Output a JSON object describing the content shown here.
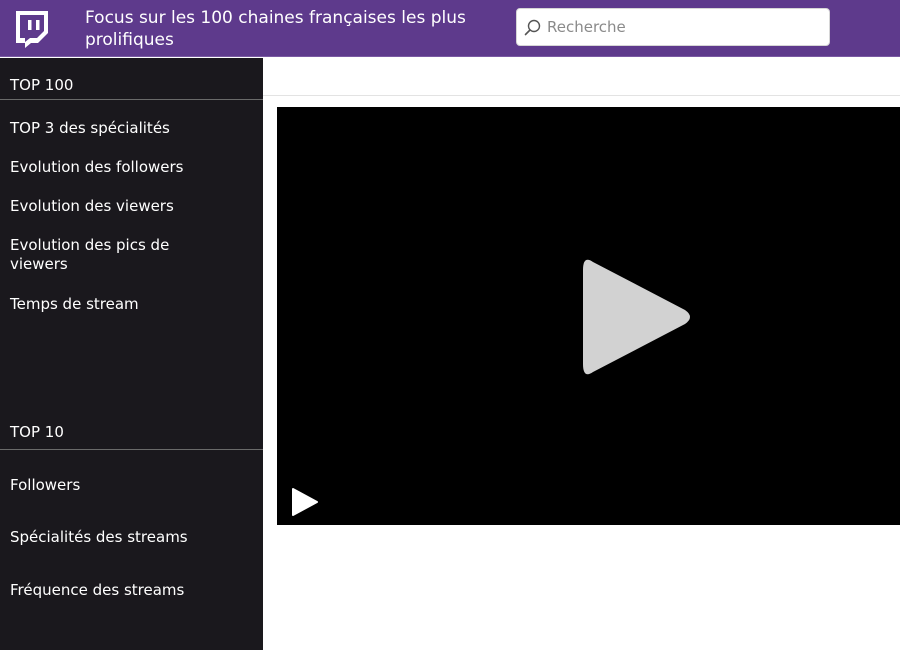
{
  "header": {
    "title": "Focus sur les 100 chaines françaises les plus prolifiques",
    "logo_icon": "twitch-logo-icon",
    "accent_color": "#5e3a8c"
  },
  "search": {
    "placeholder": "Recherche",
    "value": "",
    "icon": "search-icon"
  },
  "sidebar": {
    "top100": {
      "title": "TOP 100",
      "items": [
        {
          "label": "TOP 3 des spécialités"
        },
        {
          "label": "Evolution des followers"
        },
        {
          "label": "Evolution des viewers"
        },
        {
          "label": "Evolution des pics de viewers"
        },
        {
          "label": "Temps de stream"
        }
      ]
    },
    "top10": {
      "title": "TOP 10",
      "items": [
        {
          "label": "Followers"
        },
        {
          "label": "Spécialités des streams"
        },
        {
          "label": "Fréquence des streams"
        }
      ]
    }
  },
  "video": {
    "big_play_icon": "play-icon",
    "control_play_icon": "play-icon"
  }
}
